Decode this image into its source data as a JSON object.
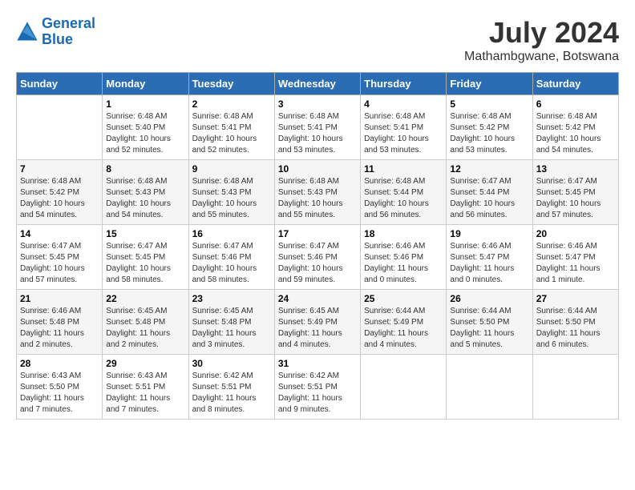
{
  "header": {
    "logo_line1": "General",
    "logo_line2": "Blue",
    "month_year": "July 2024",
    "location": "Mathambgwane, Botswana"
  },
  "weekdays": [
    "Sunday",
    "Monday",
    "Tuesday",
    "Wednesday",
    "Thursday",
    "Friday",
    "Saturday"
  ],
  "weeks": [
    [
      {
        "day": "",
        "info": ""
      },
      {
        "day": "1",
        "info": "Sunrise: 6:48 AM\nSunset: 5:40 PM\nDaylight: 10 hours\nand 52 minutes."
      },
      {
        "day": "2",
        "info": "Sunrise: 6:48 AM\nSunset: 5:41 PM\nDaylight: 10 hours\nand 52 minutes."
      },
      {
        "day": "3",
        "info": "Sunrise: 6:48 AM\nSunset: 5:41 PM\nDaylight: 10 hours\nand 53 minutes."
      },
      {
        "day": "4",
        "info": "Sunrise: 6:48 AM\nSunset: 5:41 PM\nDaylight: 10 hours\nand 53 minutes."
      },
      {
        "day": "5",
        "info": "Sunrise: 6:48 AM\nSunset: 5:42 PM\nDaylight: 10 hours\nand 53 minutes."
      },
      {
        "day": "6",
        "info": "Sunrise: 6:48 AM\nSunset: 5:42 PM\nDaylight: 10 hours\nand 54 minutes."
      }
    ],
    [
      {
        "day": "7",
        "info": "Sunrise: 6:48 AM\nSunset: 5:42 PM\nDaylight: 10 hours\nand 54 minutes."
      },
      {
        "day": "8",
        "info": "Sunrise: 6:48 AM\nSunset: 5:43 PM\nDaylight: 10 hours\nand 54 minutes."
      },
      {
        "day": "9",
        "info": "Sunrise: 6:48 AM\nSunset: 5:43 PM\nDaylight: 10 hours\nand 55 minutes."
      },
      {
        "day": "10",
        "info": "Sunrise: 6:48 AM\nSunset: 5:43 PM\nDaylight: 10 hours\nand 55 minutes."
      },
      {
        "day": "11",
        "info": "Sunrise: 6:48 AM\nSunset: 5:44 PM\nDaylight: 10 hours\nand 56 minutes."
      },
      {
        "day": "12",
        "info": "Sunrise: 6:47 AM\nSunset: 5:44 PM\nDaylight: 10 hours\nand 56 minutes."
      },
      {
        "day": "13",
        "info": "Sunrise: 6:47 AM\nSunset: 5:45 PM\nDaylight: 10 hours\nand 57 minutes."
      }
    ],
    [
      {
        "day": "14",
        "info": "Sunrise: 6:47 AM\nSunset: 5:45 PM\nDaylight: 10 hours\nand 57 minutes."
      },
      {
        "day": "15",
        "info": "Sunrise: 6:47 AM\nSunset: 5:45 PM\nDaylight: 10 hours\nand 58 minutes."
      },
      {
        "day": "16",
        "info": "Sunrise: 6:47 AM\nSunset: 5:46 PM\nDaylight: 10 hours\nand 58 minutes."
      },
      {
        "day": "17",
        "info": "Sunrise: 6:47 AM\nSunset: 5:46 PM\nDaylight: 10 hours\nand 59 minutes."
      },
      {
        "day": "18",
        "info": "Sunrise: 6:46 AM\nSunset: 5:46 PM\nDaylight: 11 hours\nand 0 minutes."
      },
      {
        "day": "19",
        "info": "Sunrise: 6:46 AM\nSunset: 5:47 PM\nDaylight: 11 hours\nand 0 minutes."
      },
      {
        "day": "20",
        "info": "Sunrise: 6:46 AM\nSunset: 5:47 PM\nDaylight: 11 hours\nand 1 minute."
      }
    ],
    [
      {
        "day": "21",
        "info": "Sunrise: 6:46 AM\nSunset: 5:48 PM\nDaylight: 11 hours\nand 2 minutes."
      },
      {
        "day": "22",
        "info": "Sunrise: 6:45 AM\nSunset: 5:48 PM\nDaylight: 11 hours\nand 2 minutes."
      },
      {
        "day": "23",
        "info": "Sunrise: 6:45 AM\nSunset: 5:48 PM\nDaylight: 11 hours\nand 3 minutes."
      },
      {
        "day": "24",
        "info": "Sunrise: 6:45 AM\nSunset: 5:49 PM\nDaylight: 11 hours\nand 4 minutes."
      },
      {
        "day": "25",
        "info": "Sunrise: 6:44 AM\nSunset: 5:49 PM\nDaylight: 11 hours\nand 4 minutes."
      },
      {
        "day": "26",
        "info": "Sunrise: 6:44 AM\nSunset: 5:50 PM\nDaylight: 11 hours\nand 5 minutes."
      },
      {
        "day": "27",
        "info": "Sunrise: 6:44 AM\nSunset: 5:50 PM\nDaylight: 11 hours\nand 6 minutes."
      }
    ],
    [
      {
        "day": "28",
        "info": "Sunrise: 6:43 AM\nSunset: 5:50 PM\nDaylight: 11 hours\nand 7 minutes."
      },
      {
        "day": "29",
        "info": "Sunrise: 6:43 AM\nSunset: 5:51 PM\nDaylight: 11 hours\nand 7 minutes."
      },
      {
        "day": "30",
        "info": "Sunrise: 6:42 AM\nSunset: 5:51 PM\nDaylight: 11 hours\nand 8 minutes."
      },
      {
        "day": "31",
        "info": "Sunrise: 6:42 AM\nSunset: 5:51 PM\nDaylight: 11 hours\nand 9 minutes."
      },
      {
        "day": "",
        "info": ""
      },
      {
        "day": "",
        "info": ""
      },
      {
        "day": "",
        "info": ""
      }
    ]
  ]
}
